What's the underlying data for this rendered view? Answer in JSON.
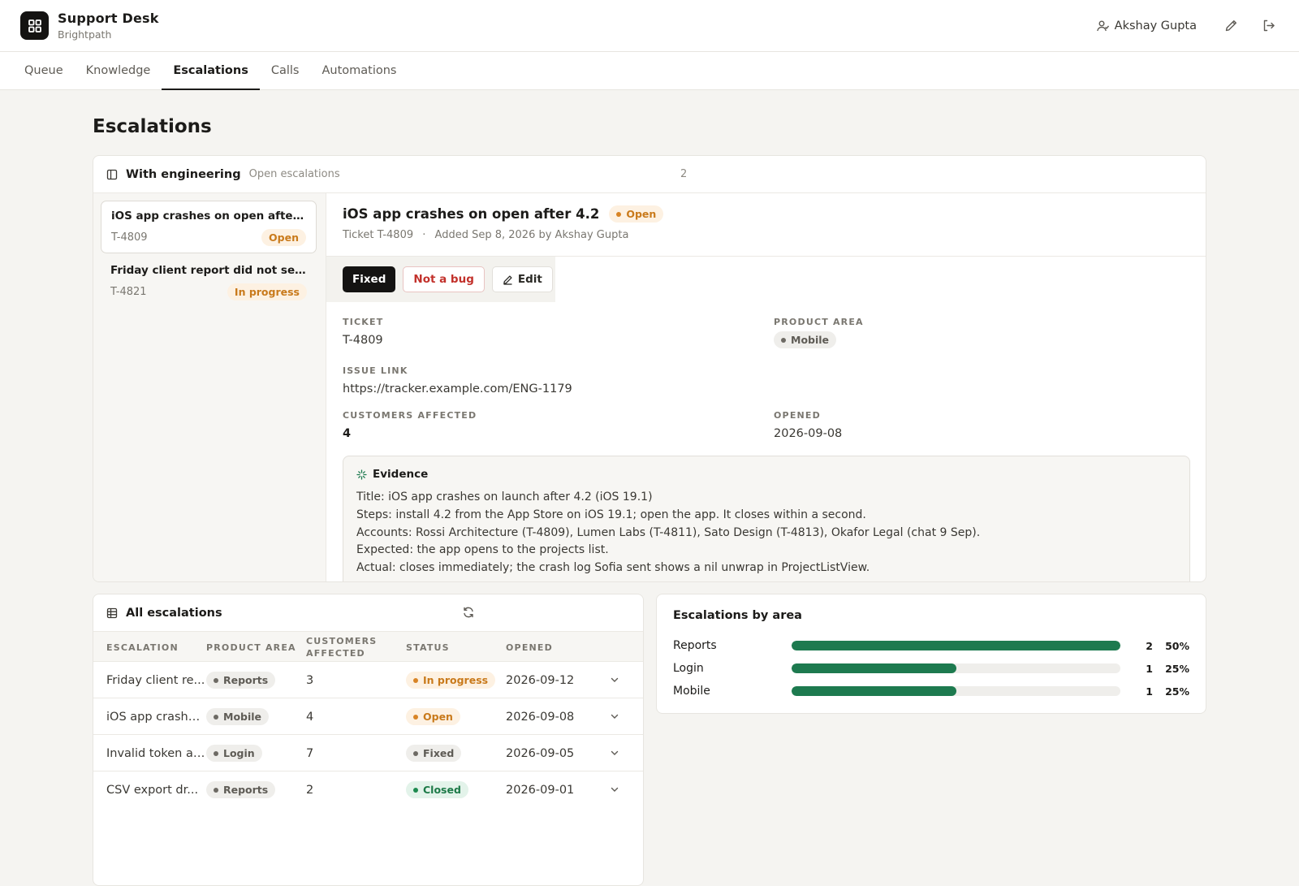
{
  "app": {
    "name": "Support Desk",
    "org": "Brightpath"
  },
  "user": {
    "name": "Akshay Gupta"
  },
  "tabs": [
    {
      "label": "Queue"
    },
    {
      "label": "Knowledge"
    },
    {
      "label": "Escalations"
    },
    {
      "label": "Calls"
    },
    {
      "label": "Automations"
    }
  ],
  "page": {
    "title": "Escalations"
  },
  "engineering": {
    "title": "With engineering",
    "subtitle": "Open escalations",
    "count": "2",
    "items": [
      {
        "title": "iOS app crashes on open after ...",
        "id": "T-4809",
        "status": "Open"
      },
      {
        "title": "Friday client report did not send",
        "id": "T-4821",
        "status": "In progress"
      }
    ]
  },
  "detail": {
    "title": "iOS app crashes on open after 4.2",
    "status": "Open",
    "ticket_ref": "Ticket T-4809",
    "added": "Added Sep 8, 2026 by Akshay Gupta",
    "actions": {
      "fixed": "Fixed",
      "not_bug": "Not a bug",
      "edit": "Edit"
    },
    "fields": {
      "ticket_label": "TICKET",
      "ticket": "T-4809",
      "area_label": "PRODUCT AREA",
      "area": "Mobile",
      "link_label": "ISSUE LINK",
      "link": "https://tracker.example.com/ENG-1179",
      "customers_label": "CUSTOMERS AFFECTED",
      "customers": "4",
      "opened_label": "OPENED",
      "opened": "2026-09-08"
    },
    "evidence": {
      "title": "Evidence",
      "lines": [
        "Title: iOS app crashes on launch after 4.2 (iOS 19.1)",
        "Steps: install 4.2 from the App Store on iOS 19.1; open the app. It closes within a second.",
        "Accounts: Rossi Architecture (T-4809), Lumen Labs (T-4811), Sato Design (T-4813), Okafor Legal (chat 9 Sep).",
        "Expected: the app opens to the projects list.",
        "Actual: closes immediately; the crash log Sofia sent shows a nil unwrap in ProjectListView."
      ]
    }
  },
  "all": {
    "title": "All escalations",
    "columns": {
      "escalation": "ESCALATION",
      "area": "PRODUCT AREA",
      "customers_1": "CUSTOMERS",
      "customers_2": "AFFECTED",
      "status": "STATUS",
      "opened": "OPENED"
    },
    "rows": [
      {
        "escalation": "Friday client re...",
        "area": "Reports",
        "customers": "3",
        "status": "In progress",
        "opened": "2026-09-12"
      },
      {
        "escalation": "iOS app crashe...",
        "area": "Mobile",
        "customers": "4",
        "status": "Open",
        "opened": "2026-09-08"
      },
      {
        "escalation": "Invalid token af...",
        "area": "Login",
        "customers": "7",
        "status": "Fixed",
        "opened": "2026-09-05"
      },
      {
        "escalation": "CSV export dr...",
        "area": "Reports",
        "customers": "2",
        "status": "Closed",
        "opened": "2026-09-01"
      }
    ]
  },
  "by_area": {
    "title": "Escalations by area",
    "color": "#1d7a4f",
    "rows": [
      {
        "label": "Reports",
        "count": "2",
        "pct": "50%",
        "fraction": 1.0
      },
      {
        "label": "Login",
        "count": "1",
        "pct": "25%",
        "fraction": 0.5
      },
      {
        "label": "Mobile",
        "count": "1",
        "pct": "25%",
        "fraction": 0.5
      }
    ]
  }
}
